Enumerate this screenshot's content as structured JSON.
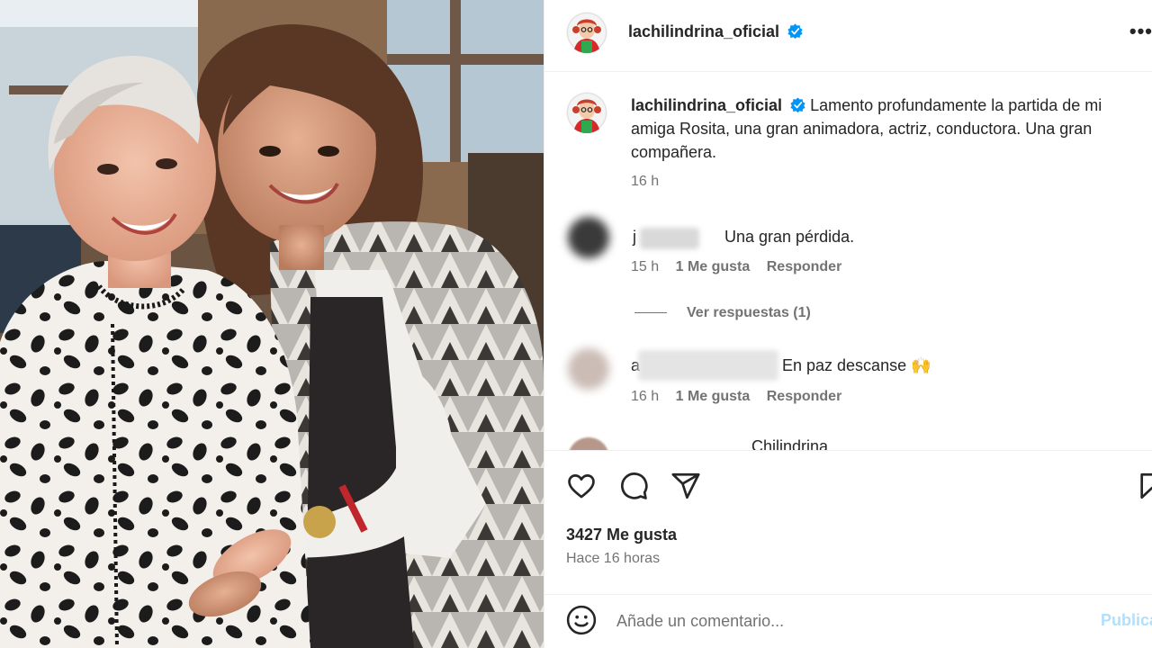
{
  "post": {
    "username": "lachilindrina_oficial",
    "caption": "Lamento profundamente la partida de mi amiga Rosita, una gran animadora, actriz, conductora. Una gran compañera.",
    "caption_time": "16 h"
  },
  "comments": [
    {
      "user_visible": "j",
      "text": "Una gran pérdida.",
      "time": "15 h",
      "likes": "1 Me gusta",
      "reply": "Responder"
    },
    {
      "user_visible": "a",
      "text": "En paz descanse 🙌",
      "time": "16 h",
      "likes": "1 Me gusta",
      "reply": "Responder"
    },
    {
      "text_partial": "Chilindrina"
    }
  ],
  "view_replies": "Ver respuestas (1)",
  "likes_count": "3427 Me gusta",
  "time_ago": "Hace 16 horas",
  "add_comment_placeholder": "Añade un comentario...",
  "publish_label": "Publicar",
  "colors": {
    "verified": "#0095f6",
    "muted": "#737373",
    "publish": "#b2dffc"
  },
  "icons": [
    "heart-icon",
    "comment-icon",
    "share-icon",
    "bookmark-icon",
    "emoji-icon",
    "more-icon",
    "verified-icon"
  ]
}
